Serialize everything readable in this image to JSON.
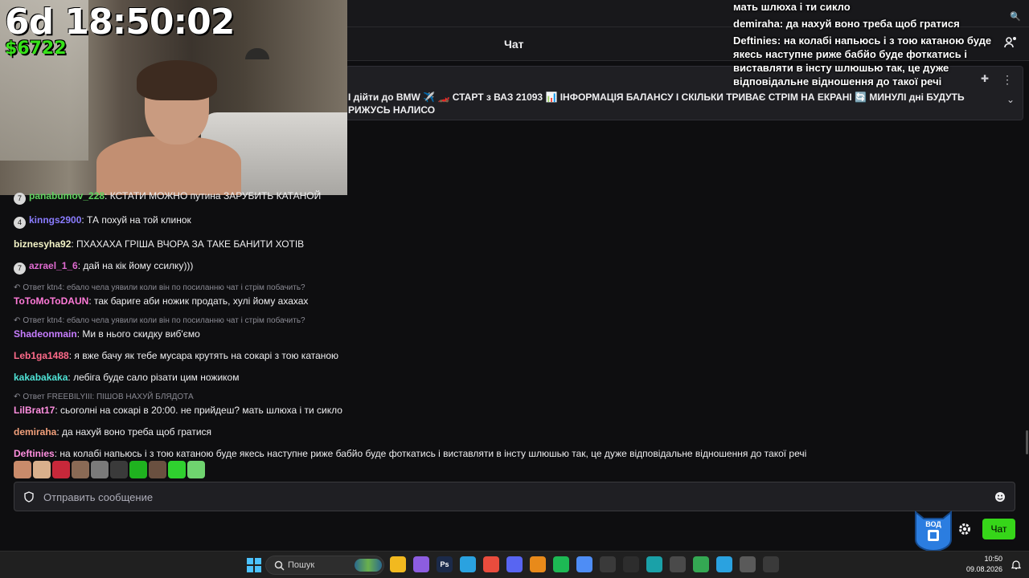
{
  "stream": {
    "timer": "6d 18:50:02",
    "money": "$6722"
  },
  "header": {
    "title": "Чат"
  },
  "pinned": {
    "text": "І дійти до BMW ✈️ 🏎️ СТАРТ з ВАЗ 21093 📊 ІНФОРМАЦІЯ БАЛАНСУ І СКІЛЬКИ ТРИВАЄ СТРІМ НА ЕКРАНІ 🔄 МИНУЛІ дні БУДУТЬ РИЖУСЬ НАЛИСО"
  },
  "overlay": {
    "lines": [
      "мать шлюха і ти сикло",
      "demiraha: да нахуй воно треба щоб гратися",
      "Deftinies: на колабі напьюсь і з тою катаною буде якесь наступне риже бабйо буде фоткатись і виставляти в інсту шлюшью так, це дуже відповідальне відношення до такої речі"
    ]
  },
  "messages": [
    {
      "badge": "7",
      "user": "panabumov_228",
      "color": "#5fd35f",
      "text": "КСТАТИ МОЖНО путина ЗАРУБИТЬ КАТАНОЙ"
    },
    {
      "badge": "4",
      "user": "kinngs2900",
      "color": "#8a7cff",
      "text": "ТА похуй на той клинок"
    },
    {
      "badge": "",
      "user": "biznesyha92",
      "color": "#f5f5c8",
      "text": "ПХАХАХА ГРІША ВЧОРА ЗА ТАКЕ БАНИТИ ХОТІВ"
    },
    {
      "badge": "7",
      "user": "azrael_1_6",
      "color": "#e06bd1",
      "text": "дай на кік йому ссилку)))"
    },
    {
      "reply": "Ответ ktn4: ебало чела уявили коли він по посиланню чат і стрім побачить?",
      "badge": "",
      "user": "ToToMoToDAUN",
      "color": "#ff7ad8",
      "text": "так бариге аби ножик продать, хулі йому ахахах"
    },
    {
      "reply": "Ответ ktn4: ебало чела уявили коли він по посиланню чат і стрім побачить?",
      "badge": "",
      "user": "Shadeonmain",
      "color": "#c77dff",
      "text": "Ми в нього скидку виб'ємо"
    },
    {
      "badge": "",
      "user": "Leb1ga1488",
      "color": "#ff6b8a",
      "text": "я вже бачу як тебе мусара крутять на сокарі з тою катаною"
    },
    {
      "badge": "",
      "user": "kakabakaka",
      "color": "#4fe3d6",
      "text": "лебіга буде сало різати цим ножиком"
    },
    {
      "reply": "Ответ FREEBILYIII: ПІШОВ НАХУЙ БЛЯДОТА",
      "badge": "",
      "user": "LilBrat17",
      "color": "#ff8fe0",
      "text": "сьоголні на сокарі в 20:00. не прийдеш? мать шлюха і ти сикло"
    },
    {
      "badge": "",
      "user": "demiraha",
      "color": "#f2a07b",
      "text": "да нахуй воно треба щоб гратися"
    },
    {
      "badge": "",
      "user": "Deftinies",
      "color": "#ff8fe0",
      "text": "на колабі напьюсь і з тою катаною буде якесь наступне риже бабйо буде фоткатись і виставляти в інсту шлюшью так, це дуже відповідальне відношення до такої речі"
    }
  ],
  "emotes": [
    "#c98b6b",
    "#d9b08c",
    "#c7283a",
    "#8a6a55",
    "#7a7a7a",
    "#3a3a3a",
    "#1fb21f",
    "#6a5040",
    "#2fd12f",
    "#6fd36f"
  ],
  "input": {
    "placeholder": "Отправить сообщение"
  },
  "controls": {
    "chat_button": "Чат",
    "mascot_label": "ВОД"
  },
  "taskbar": {
    "search_label": "Пошук",
    "time": "10:50",
    "date": "09.08.2026",
    "apps": [
      {
        "name": "file-explorer-icon",
        "color": "#f2b91f",
        "label": ""
      },
      {
        "name": "twitch-icon",
        "color": "#8d5de0",
        "label": ""
      },
      {
        "name": "photoshop-icon",
        "color": "#1b2a4a",
        "label": "Ps"
      },
      {
        "name": "telegram-icon",
        "color": "#2aa2e0",
        "label": ""
      },
      {
        "name": "chrome-icon",
        "color": "#e94c3d",
        "label": ""
      },
      {
        "name": "discord-icon",
        "color": "#5865f2",
        "label": ""
      },
      {
        "name": "fl-studio-icon",
        "color": "#e88a1a",
        "label": ""
      },
      {
        "name": "spotify-icon",
        "color": "#1db954",
        "label": ""
      },
      {
        "name": "chrome-profile-icon",
        "color": "#4e8df5",
        "label": ""
      },
      {
        "name": "obs-icon",
        "color": "#3a3a3a",
        "label": ""
      },
      {
        "name": "capcut-icon",
        "color": "#2d2d2d",
        "label": ""
      },
      {
        "name": "edge-icon",
        "color": "#1aa1a8",
        "label": ""
      },
      {
        "name": "terminal-icon",
        "color": "#4a4a4a",
        "label": ""
      },
      {
        "name": "chrome-alt-icon",
        "color": "#34a853",
        "label": ""
      },
      {
        "name": "telegram-alt-icon",
        "color": "#2aa2e0",
        "label": ""
      },
      {
        "name": "calculator-icon",
        "color": "#5a5a5a",
        "label": ""
      },
      {
        "name": "media-player-icon",
        "color": "#3a3a3a",
        "label": ""
      }
    ]
  }
}
